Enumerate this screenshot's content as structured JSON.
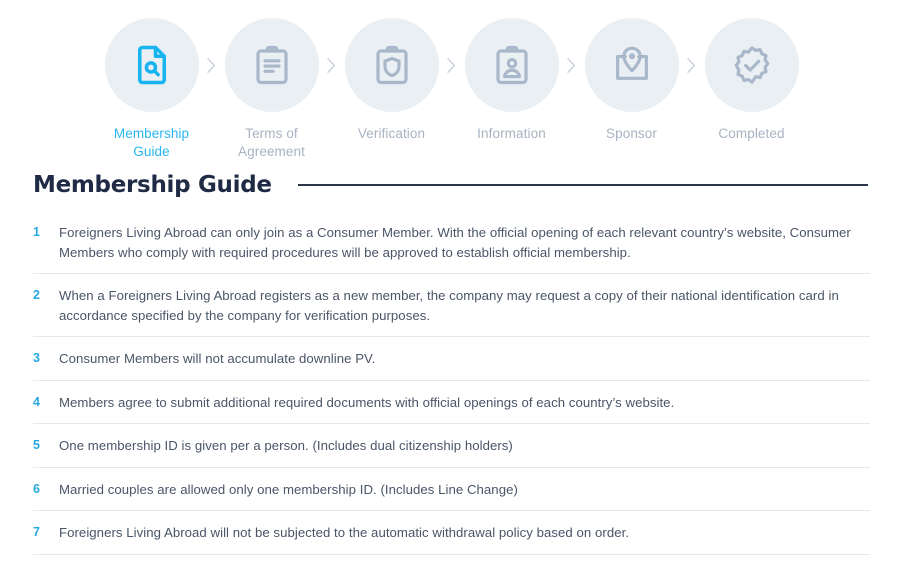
{
  "colors": {
    "accent": "#29b6f1",
    "number": "#29a8e0",
    "circle_bg": "#eaeff4",
    "icon_inactive": "#a8b7c9",
    "label_inactive": "#a8b3c2",
    "title": "#1f2b44",
    "body_text": "#4a5568",
    "divider": "#e4e9ee"
  },
  "stepper": {
    "separator_icon": "chevron-right-icon",
    "steps": [
      {
        "label": "Membership Guide",
        "icon": "document-search-icon",
        "state": "active"
      },
      {
        "label": "Terms of Agreement",
        "icon": "clipboard-lines-icon",
        "state": "inactive"
      },
      {
        "label": "Verification",
        "icon": "clipboard-shield-icon",
        "state": "inactive"
      },
      {
        "label": "Information",
        "icon": "id-card-person-icon",
        "state": "inactive"
      },
      {
        "label": "Sponsor",
        "icon": "map-pin-icon",
        "state": "inactive"
      },
      {
        "label": "Completed",
        "icon": "badge-check-icon",
        "state": "inactive"
      }
    ]
  },
  "section": {
    "title": "Membership Guide"
  },
  "guide": {
    "items": [
      {
        "number": "1",
        "text": "Foreigners Living Abroad can only join as a Consumer Member. With the official opening of each relevant country’s website, Consumer Members who comply with required procedures will be approved to establish official membership."
      },
      {
        "number": "2",
        "text": "When a Foreigners Living Abroad registers as a new member, the company may request a copy of their national identification card in accordance specified by the company for verification purposes."
      },
      {
        "number": "3",
        "text": "Consumer Members will not accumulate downline PV."
      },
      {
        "number": "4",
        "text": "Members agree to submit additional required documents with official openings of each country’s website."
      },
      {
        "number": "5",
        "text": "One membership ID is given per a person. (Includes dual citizenship holders)"
      },
      {
        "number": "6",
        "text": "Married couples are allowed only one membership ID. (Includes Line Change)"
      },
      {
        "number": "7",
        "text": "Foreigners Living Abroad will not be subjected to the automatic withdrawal policy based on order."
      }
    ]
  }
}
